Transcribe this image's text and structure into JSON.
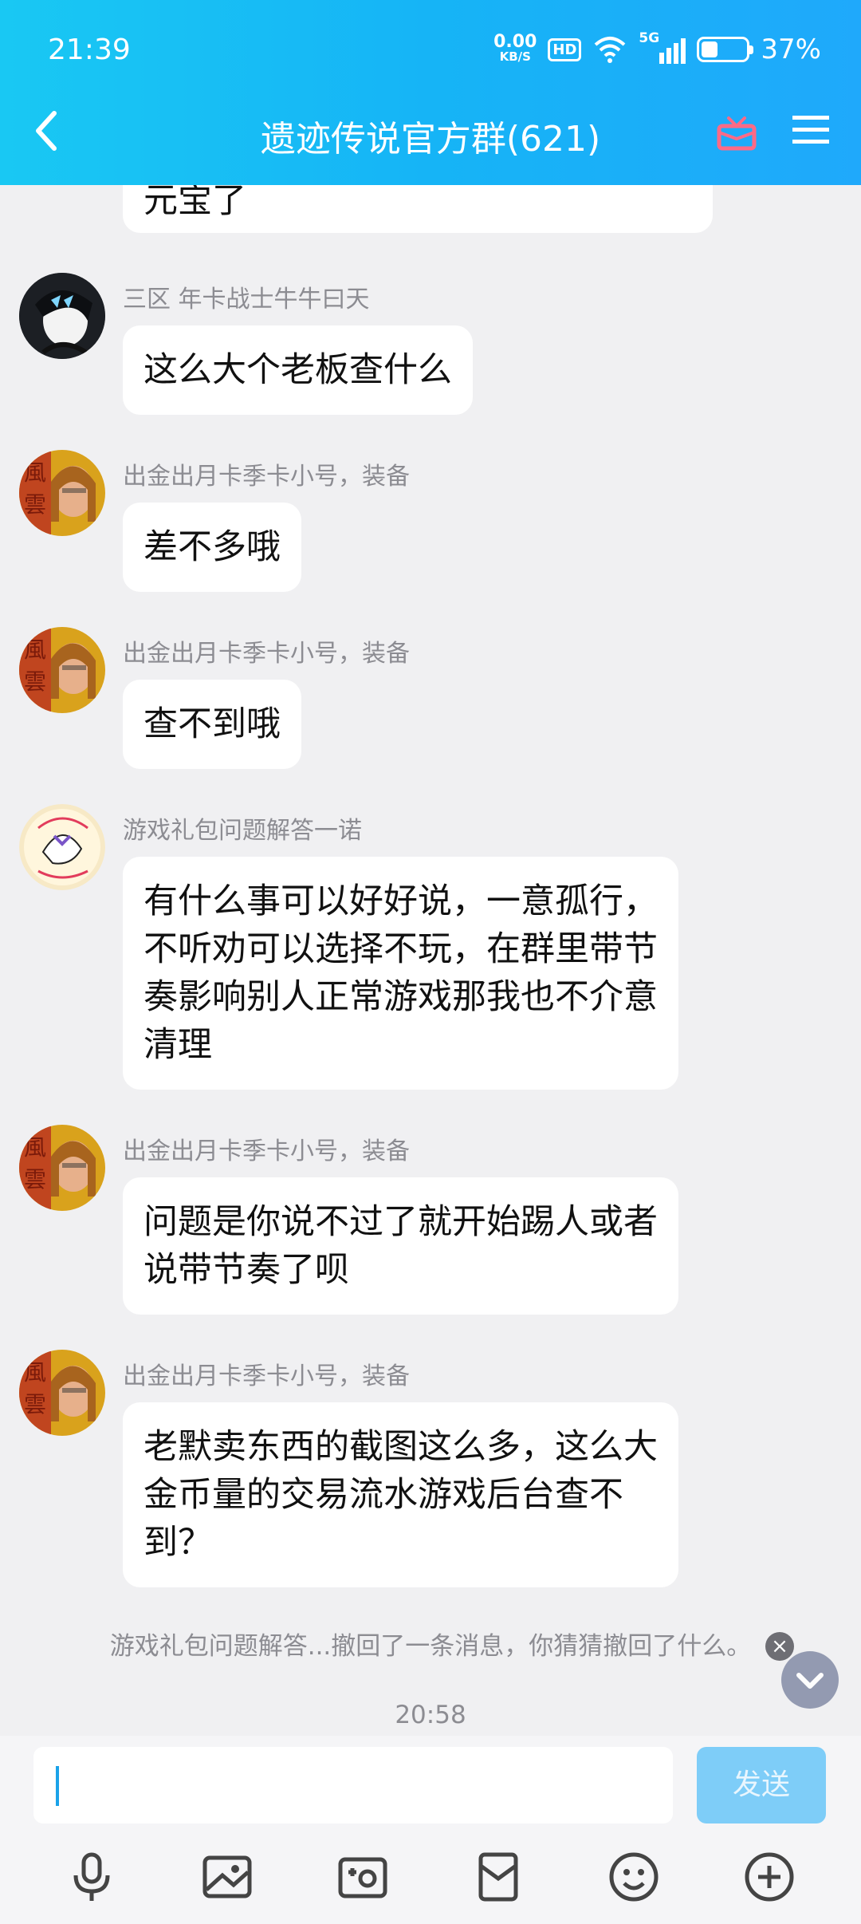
{
  "status_bar": {
    "time": "21:39",
    "net_speed": "0.00",
    "net_unit": "KB/S",
    "hd": "HD",
    "signal": "5G",
    "battery": "37%",
    "battery_level": 0.37
  },
  "header": {
    "title": "遗迹传说官方群(621)"
  },
  "messages": [
    {
      "sender": "",
      "text": "元宝了",
      "avatar": "none"
    },
    {
      "sender": "三区 年卡战士牛牛曰天",
      "text": "这么大个老板查什么",
      "avatar": "anime-avatar"
    },
    {
      "sender": "出金出月卡季卡小号，装备",
      "text": "差不多哦",
      "avatar": "person-avatar"
    },
    {
      "sender": "出金出月卡季卡小号，装备",
      "text": "查不到哦",
      "avatar": "person-avatar"
    },
    {
      "sender": "游戏礼包问题解答一诺",
      "lines": [
        "有什么事可以好好说，一意孤行，",
        "不听劝可以选择不玩，在群里带节",
        "奏影响别人正常游戏那我也不介意",
        "清理"
      ],
      "avatar": "cartoon-avatar"
    },
    {
      "sender": "出金出月卡季卡小号，装备",
      "lines": [
        "问题是你说不过了就开始踢人或者",
        "说带节奏了呗"
      ],
      "avatar": "person-avatar"
    },
    {
      "sender": "出金出月卡季卡小号，装备",
      "lines": [
        "老默卖东西的截图这么多，这么大",
        "金币量的交易流水游戏后台查不",
        "到？"
      ],
      "avatar": "person-avatar"
    }
  ],
  "recall_notice": "游戏礼包问题解答...撤回了一条消息，你猜猜撤回了什么。",
  "timestamp": "20:58",
  "input": {
    "value": "",
    "send_label": "发送"
  },
  "toolbar_icons": [
    "microphone-icon",
    "image-icon",
    "camera-icon",
    "red-packet-icon",
    "emoji-icon",
    "plus-icon"
  ]
}
